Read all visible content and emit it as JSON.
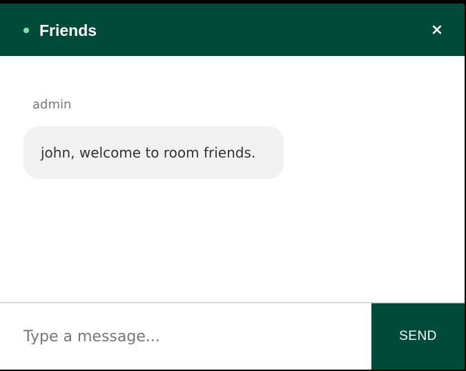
{
  "colors": {
    "header_background": "#004a3a",
    "status_online": "#7fe3a6",
    "bubble_background": "#f1f1f1",
    "send_background": "#004a3a"
  },
  "header": {
    "status_icon": "online-status-dot",
    "title": "Friends",
    "close_label": "×"
  },
  "messages": [
    {
      "sender": "admin",
      "text": "john, welcome to room friends."
    }
  ],
  "composer": {
    "placeholder": "Type a message...",
    "value": "",
    "send_label": "SEND"
  }
}
